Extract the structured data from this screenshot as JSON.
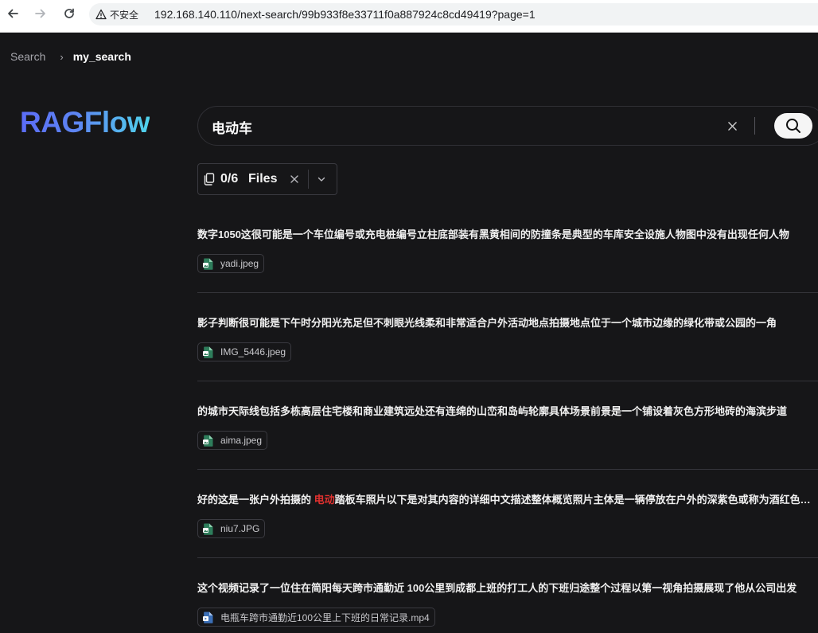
{
  "browser": {
    "security_label": "不安全",
    "url": "192.168.140.110/next-search/99b933f8e33711f0a887924c8cd49419?page=1"
  },
  "breadcrumb": {
    "root": "Search",
    "separator": "›",
    "current": "my_search"
  },
  "logo": {
    "text": "RAGFlow"
  },
  "search": {
    "value": "电动车",
    "placeholder": ""
  },
  "files_filter": {
    "count": "0/6",
    "label": "Files"
  },
  "results": [
    {
      "before": "数字1050这很可能是一个车位编号或充电桩编号立柱底部装有黑黄相间的防撞条是典型的车库安全设施人物图中没有出现任何人物",
      "highlight": "",
      "after": "",
      "file": "yadi.jpeg",
      "file_type": "image"
    },
    {
      "before": "影子判断很可能是下午时分阳光充足但不刺眼光线柔和非常适合户外活动地点拍摄地点位于一个城市边缘的绿化带或公园的一角",
      "highlight": "",
      "after": "",
      "file": "IMG_5446.jpeg",
      "file_type": "image"
    },
    {
      "before": "的城市天际线包括多栋高层住宅楼和商业建筑远处还有连绵的山峦和岛屿轮廓具体场景前景是一个铺设着灰色方形地砖的海滨步道",
      "highlight": "",
      "after": "",
      "file": "aima.jpeg",
      "file_type": "image"
    },
    {
      "before": "好的这是一张户外拍摄的 ",
      "highlight": "电动",
      "after": "踏板车照片以下是对其内容的详细中文描述整体概览照片主体是一辆停放在户外的深紫色或称为酒红色的车辆",
      "file": "niu7.JPG",
      "file_type": "image"
    },
    {
      "before": "这个视频记录了一位住在简阳每天跨市通勤近 100公里到成都上班的打工人的下班归途整个过程以第一视角拍摄展现了他从公司出发",
      "highlight": "",
      "after": "",
      "file": "电瓶车跨市通勤近100公里上下班的日常记录.mp4",
      "file_type": "video"
    }
  ],
  "colors": {
    "background": "#161618",
    "highlight": "#e0312f",
    "logo_gradient": [
      "#5b6cf6",
      "#50d4ec"
    ]
  }
}
